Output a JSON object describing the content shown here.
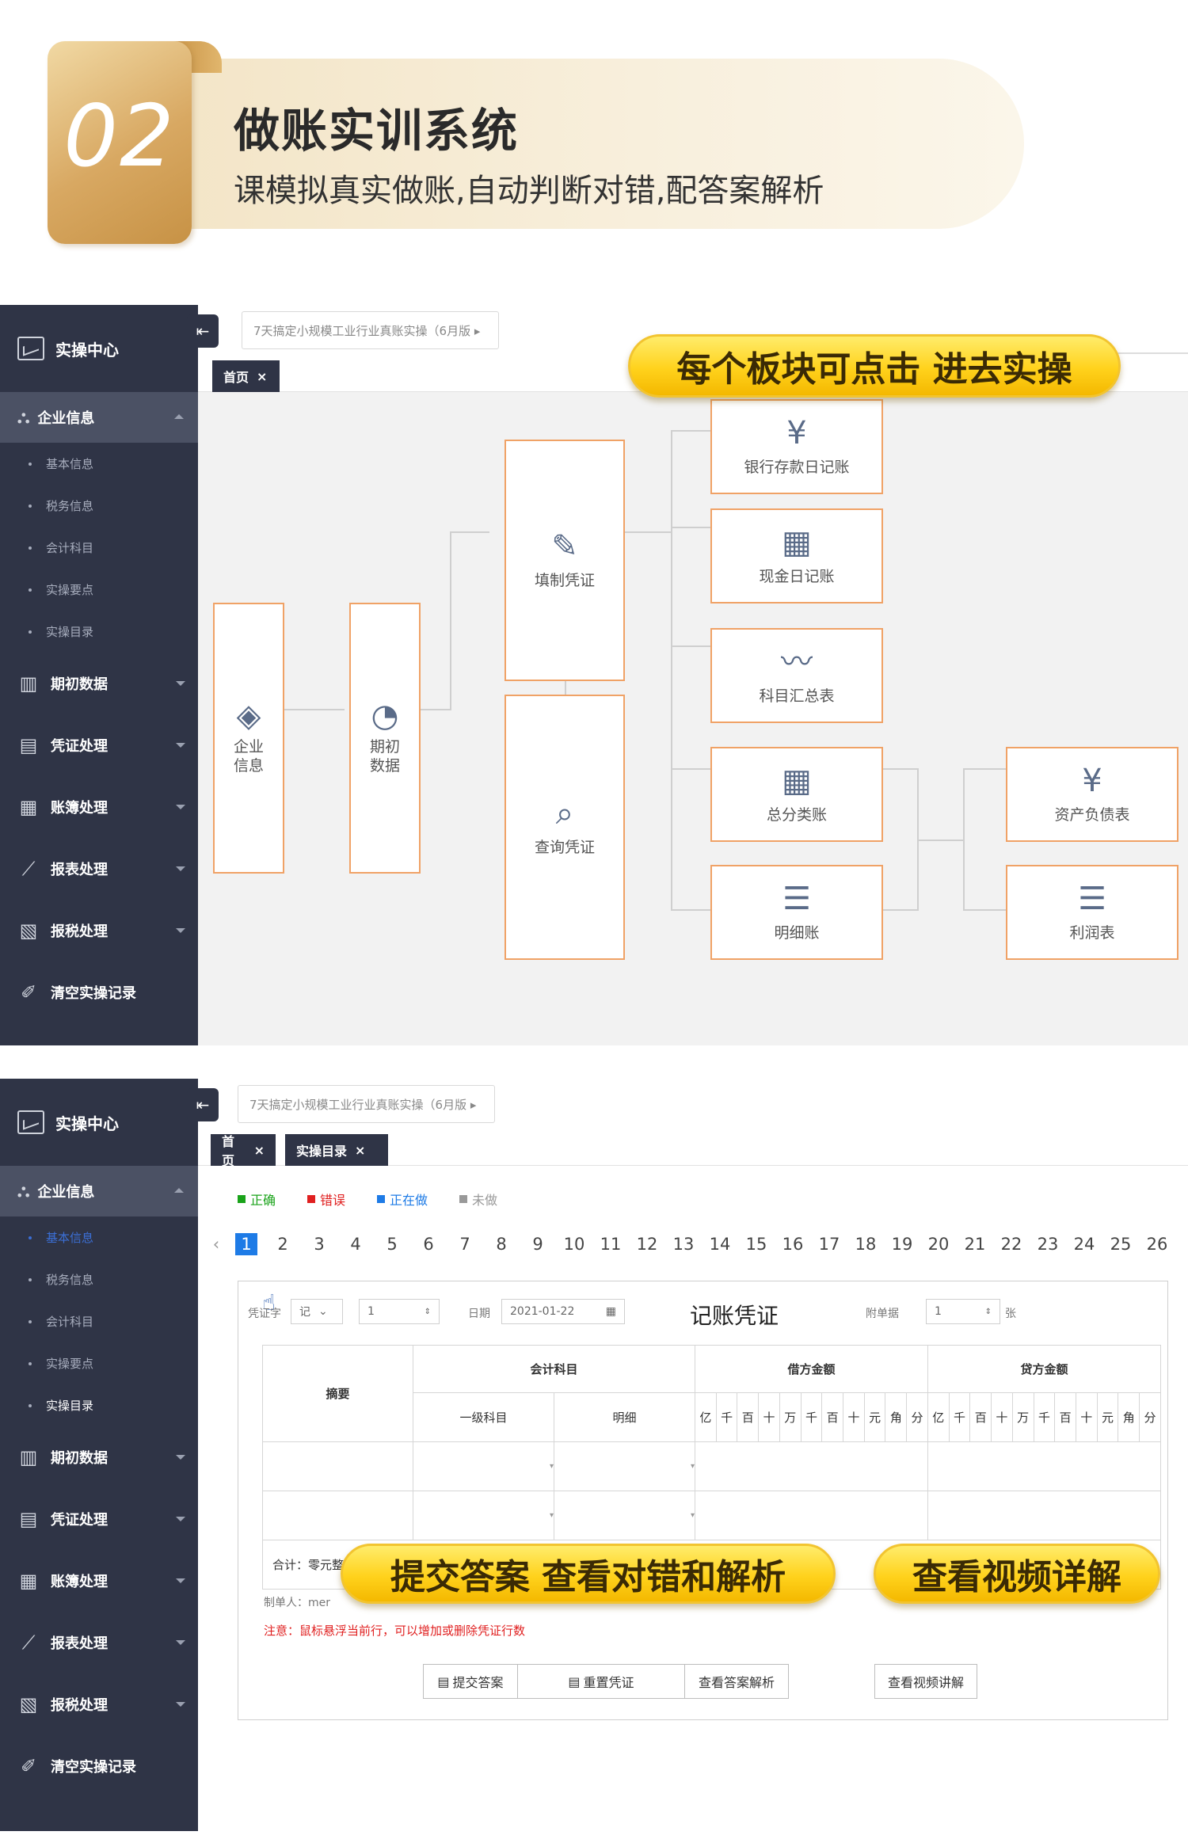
{
  "header": {
    "number": "02",
    "title": "做账实训系统",
    "subtitle": "课模拟真实做账,自动判断对错,配答案解析"
  },
  "sidebar": {
    "title": "实操中心",
    "active_group": "企业信息",
    "sub_items": [
      "基本信息",
      "税务信息",
      "会计科目",
      "实操要点",
      "实操目录"
    ],
    "items": [
      "期初数据",
      "凭证处理",
      "账簿处理",
      "报表处理",
      "报税处理",
      "清空实操记录"
    ]
  },
  "screen1": {
    "breadcrumb": "7天搞定小规模工业行业真账实操（6月版 ▸",
    "tab_home": "首页",
    "tab_close": "×",
    "callout": "每个板块可点击 进去实操",
    "nodes": {
      "company": "企业\n信息",
      "opening": "期初\n数据",
      "fill_voucher": "填制凭证",
      "query_voucher": "查询凭证",
      "bank_journal": "银行存款日记账",
      "cash_journal": "现金日记账",
      "account_summary": "科目汇总表",
      "general_ledger": "总分类账",
      "detail_ledger": "明细账",
      "balance_sheet": "资产负债表",
      "income_statement": "利润表"
    }
  },
  "screen2": {
    "breadcrumb": "7天搞定小规模工业行业真账实操（6月版 ▸",
    "tab_home": "首页",
    "tab_catalog": "实操目录",
    "tab_close": "×",
    "legend": [
      {
        "label": "正确",
        "color": "#1aa31a"
      },
      {
        "label": "错误",
        "color": "#e02020"
      },
      {
        "label": "正在做",
        "color": "#1e7be6"
      },
      {
        "label": "未做",
        "color": "#999999"
      }
    ],
    "pager_prev": "‹",
    "pages": [
      "1",
      "2",
      "3",
      "4",
      "5",
      "6",
      "7",
      "8",
      "9",
      "10",
      "11",
      "12",
      "13",
      "14",
      "15",
      "16",
      "17",
      "18",
      "19",
      "20",
      "21",
      "22",
      "23",
      "24",
      "25",
      "26"
    ],
    "voucher": {
      "word_label": "凭证字",
      "word_value": "记",
      "number_value": "1",
      "date_label": "日期",
      "date_value": "2021-01-22",
      "title": "记账凭证",
      "attach_label": "附单据",
      "attach_value": "1",
      "attach_unit": "张",
      "col_summary": "摘要",
      "col_account": "会计科目",
      "col_debit": "借方金额",
      "col_credit": "贷方金额",
      "col_level1": "一级科目",
      "col_detail": "明细",
      "digits": [
        "亿",
        "千",
        "百",
        "十",
        "万",
        "千",
        "百",
        "十",
        "元",
        "角",
        "分"
      ],
      "total_label": "合计：零元整",
      "maker_label": "制单人：mer",
      "note": "注意：鼠标悬浮当前行，可以增加或删除凭证行数"
    },
    "callout_left": "提交答案 查看对错和解析",
    "callout_right": "查看视频详解",
    "buttons": {
      "submit": "提交答案",
      "reset": "重置凭证",
      "view_answer": "查看答案解析",
      "view_video": "查看视频讲解"
    }
  }
}
